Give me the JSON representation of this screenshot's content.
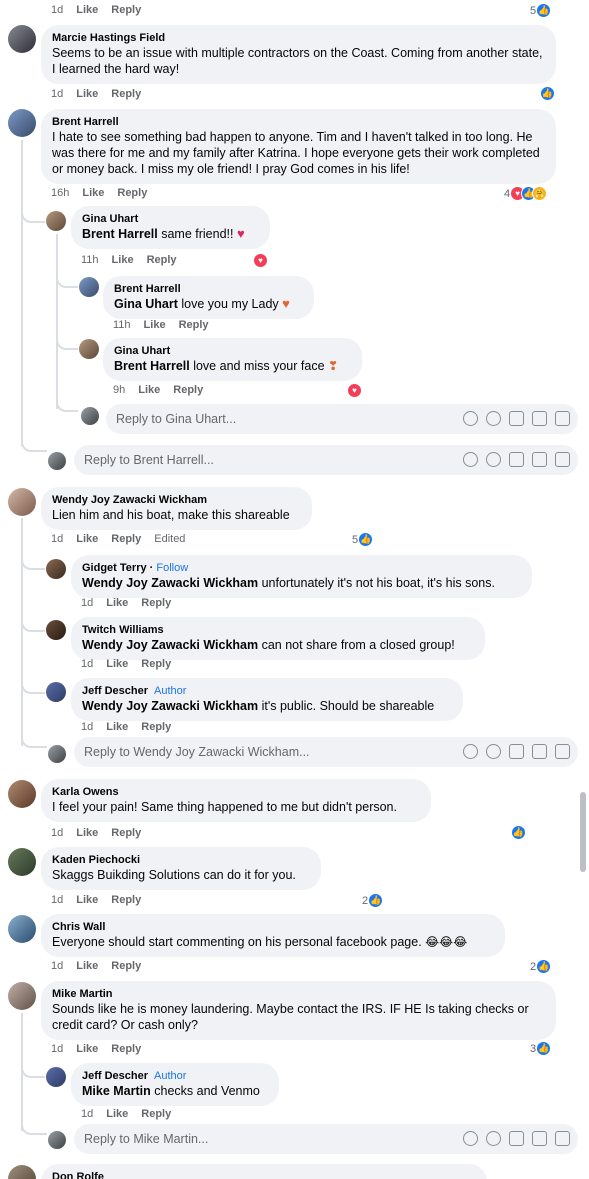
{
  "actions": {
    "like": "Like",
    "reply": "Reply",
    "edited": "Edited",
    "follow": "Follow",
    "author": "Author"
  },
  "top": {
    "time": "1d",
    "count": "5"
  },
  "c1": {
    "name": "Marcie Hastings Field",
    "text": "Seems to be an issue with multiple contractors on the Coast. Coming from another state, I learned the hard way!",
    "time": "1d"
  },
  "c2": {
    "name": "Brent Harrell",
    "text": "I hate to see something bad happen to anyone. Tim and I haven't talked in too long. He was there for me and my family after Katrina. I hope everyone gets their work completed or money back. I miss my ole friend! I pray God comes in his life!",
    "time": "16h",
    "count": "4"
  },
  "r21": {
    "name": "Gina Uhart",
    "mention": "Brent Harrell",
    "text": " same friend!!",
    "time": "11h"
  },
  "r22": {
    "name": "Brent Harrell",
    "mention": "Gina Uhart",
    "text": " love you my Lady",
    "time": "11h"
  },
  "r23": {
    "name": "Gina Uhart",
    "mention": "Brent Harrell",
    "text": " love and miss your face",
    "time": "9h"
  },
  "reply_gina": "Reply to Gina Uhart...",
  "reply_brent": "Reply to Brent Harrell...",
  "c3": {
    "name": "Wendy Joy Zawacki Wickham",
    "text": "Lien him and his boat, make this shareable",
    "time": "1d",
    "count": "5"
  },
  "r31": {
    "name": "Gidget Terry",
    "mention": "Wendy Joy Zawacki Wickham",
    "text": " unfortunately it's not his boat, it's his sons.",
    "time": "1d"
  },
  "r32": {
    "name": "Twitch Williams",
    "mention": "Wendy Joy Zawacki Wickham",
    "text": " can not share from a closed group!",
    "time": "1d"
  },
  "r33": {
    "name": "Jeff Descher",
    "mention": "Wendy Joy Zawacki Wickham",
    "text": " it's public. Should be shareable",
    "time": "1d"
  },
  "reply_wendy": "Reply to Wendy Joy Zawacki Wickham...",
  "c4": {
    "name": "Karla Owens",
    "text": "I feel your pain! Same thing happened to me but didn't person.",
    "time": "1d"
  },
  "c5": {
    "name": "Kaden Piechocki",
    "text": "Skaggs Buikding Solutions can do it for you.",
    "time": "1d",
    "count": "2"
  },
  "c6": {
    "name": "Chris Wall",
    "text": "Everyone should start commenting on his personal facebook page.",
    "time": "1d",
    "count": "2"
  },
  "c7": {
    "name": "Mike Martin",
    "text": "Sounds like he is money laundering. Maybe contact the IRS. IF HE Is taking checks or credit card? Or cash only?",
    "time": "1d",
    "count": "3"
  },
  "r71": {
    "name": "Jeff Descher",
    "mention": "Mike Martin",
    "text": " checks and Venmo",
    "time": "1d"
  },
  "reply_mike": "Reply to Mike Martin...",
  "c8": {
    "name": "Don Rolfe"
  },
  "colors": {
    "bubble": "#f0f2f5",
    "link": "#1b74e4",
    "like": "#1877f2",
    "love": "#f33e58",
    "muted": "#65676b"
  },
  "icons": [
    "emoji-icon",
    "smiley-icon",
    "camera-icon",
    "gif-icon",
    "sticker-icon",
    "like-reaction-icon",
    "love-reaction-icon",
    "care-reaction-icon",
    "laughing-emoji-icon"
  ]
}
